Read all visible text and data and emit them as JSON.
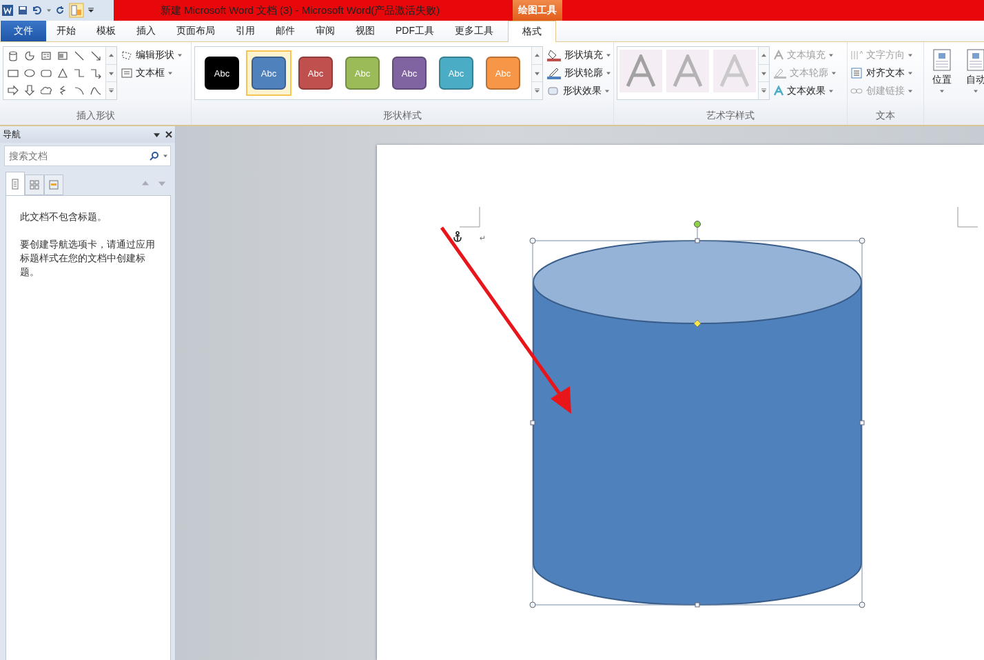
{
  "title_bar": {
    "title": "新建 Microsoft Word 文档 (3)  -  Microsoft Word(产品激活失败)",
    "context_label": "绘图工具"
  },
  "menu_tabs": [
    {
      "label": "文件",
      "kind": "file",
      "selected": false
    },
    {
      "label": "开始",
      "kind": "normal",
      "selected": false
    },
    {
      "label": "模板",
      "kind": "normal",
      "selected": false
    },
    {
      "label": "插入",
      "kind": "normal",
      "selected": false
    },
    {
      "label": "页面布局",
      "kind": "normal",
      "selected": false
    },
    {
      "label": "引用",
      "kind": "normal",
      "selected": false
    },
    {
      "label": "邮件",
      "kind": "normal",
      "selected": false
    },
    {
      "label": "审阅",
      "kind": "normal",
      "selected": false
    },
    {
      "label": "视图",
      "kind": "normal",
      "selected": false
    },
    {
      "label": "PDF工具",
      "kind": "normal",
      "selected": false
    },
    {
      "label": "更多工具",
      "kind": "normal",
      "selected": false
    },
    {
      "label": "格式",
      "kind": "contextual",
      "selected": true
    }
  ],
  "insert_shapes": {
    "label": "插入形状",
    "commands": [
      {
        "label": "编辑形状"
      },
      {
        "label": "文本框"
      }
    ]
  },
  "shape_styles": {
    "label": "形状样式",
    "swatches": [
      {
        "label": "Abc",
        "color": "#000000",
        "selected": false
      },
      {
        "label": "Abc",
        "color": "#4f81bd",
        "selected": true
      },
      {
        "label": "Abc",
        "color": "#c0504d",
        "selected": false
      },
      {
        "label": "Abc",
        "color": "#9bbb59",
        "selected": false
      },
      {
        "label": "Abc",
        "color": "#8064a2",
        "selected": false
      },
      {
        "label": "Abc",
        "color": "#4bacc6",
        "selected": false
      },
      {
        "label": "Abc",
        "color": "#f79646",
        "selected": false
      }
    ],
    "commands": [
      {
        "label": "形状填充"
      },
      {
        "label": "形状轮廓"
      },
      {
        "label": "形状效果"
      }
    ]
  },
  "wordart_styles": {
    "label": "艺术字样式",
    "commands": [
      {
        "label": "文本填充",
        "disabled": true
      },
      {
        "label": "文本轮廓",
        "disabled": true
      },
      {
        "label": "文本效果",
        "disabled": false
      }
    ]
  },
  "text_group": {
    "label": "文本",
    "commands": [
      {
        "label": "文字方向",
        "disabled": true
      },
      {
        "label": "对齐文本",
        "disabled": false
      },
      {
        "label": "创建链接",
        "disabled": true
      }
    ]
  },
  "arrange": {
    "commands": [
      {
        "label": "位置"
      },
      {
        "label": "自动"
      }
    ]
  },
  "nav_pane": {
    "title": "导航",
    "search": {
      "placeholder": "搜索文档"
    },
    "tabs": [
      {
        "selected": true
      },
      {
        "selected": false
      },
      {
        "selected": false
      }
    ],
    "messages": [
      "此文档不包含标题。",
      "要创建导航选项卡，请通过应用标题样式在您的文档中创建标题。"
    ]
  },
  "document": {
    "paragraph_mark": "↵"
  }
}
